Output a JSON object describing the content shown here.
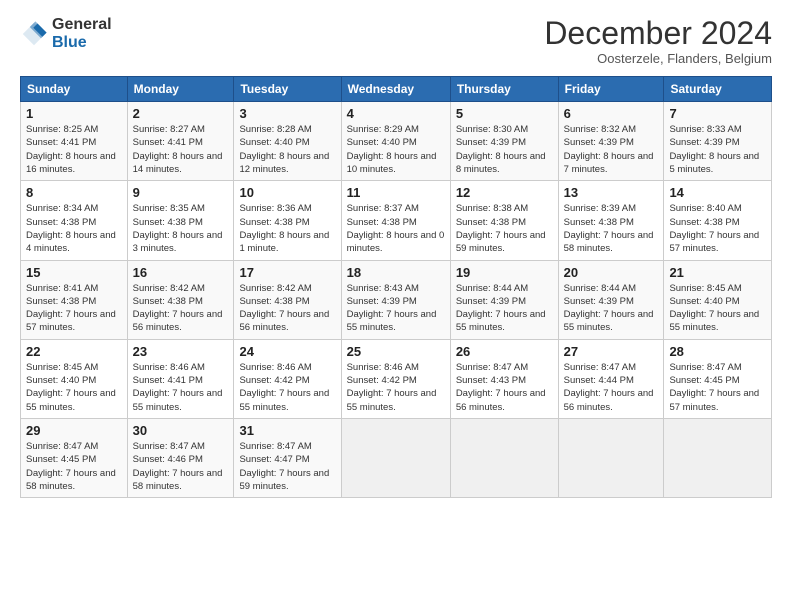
{
  "logo": {
    "line1": "General",
    "line2": "Blue"
  },
  "title": "December 2024",
  "subtitle": "Oosterzele, Flanders, Belgium",
  "headers": [
    "Sunday",
    "Monday",
    "Tuesday",
    "Wednesday",
    "Thursday",
    "Friday",
    "Saturday"
  ],
  "weeks": [
    [
      {
        "day": "1",
        "sunrise": "Sunrise: 8:25 AM",
        "sunset": "Sunset: 4:41 PM",
        "daylight": "Daylight: 8 hours and 16 minutes."
      },
      {
        "day": "2",
        "sunrise": "Sunrise: 8:27 AM",
        "sunset": "Sunset: 4:41 PM",
        "daylight": "Daylight: 8 hours and 14 minutes."
      },
      {
        "day": "3",
        "sunrise": "Sunrise: 8:28 AM",
        "sunset": "Sunset: 4:40 PM",
        "daylight": "Daylight: 8 hours and 12 minutes."
      },
      {
        "day": "4",
        "sunrise": "Sunrise: 8:29 AM",
        "sunset": "Sunset: 4:40 PM",
        "daylight": "Daylight: 8 hours and 10 minutes."
      },
      {
        "day": "5",
        "sunrise": "Sunrise: 8:30 AM",
        "sunset": "Sunset: 4:39 PM",
        "daylight": "Daylight: 8 hours and 8 minutes."
      },
      {
        "day": "6",
        "sunrise": "Sunrise: 8:32 AM",
        "sunset": "Sunset: 4:39 PM",
        "daylight": "Daylight: 8 hours and 7 minutes."
      },
      {
        "day": "7",
        "sunrise": "Sunrise: 8:33 AM",
        "sunset": "Sunset: 4:39 PM",
        "daylight": "Daylight: 8 hours and 5 minutes."
      }
    ],
    [
      {
        "day": "8",
        "sunrise": "Sunrise: 8:34 AM",
        "sunset": "Sunset: 4:38 PM",
        "daylight": "Daylight: 8 hours and 4 minutes."
      },
      {
        "day": "9",
        "sunrise": "Sunrise: 8:35 AM",
        "sunset": "Sunset: 4:38 PM",
        "daylight": "Daylight: 8 hours and 3 minutes."
      },
      {
        "day": "10",
        "sunrise": "Sunrise: 8:36 AM",
        "sunset": "Sunset: 4:38 PM",
        "daylight": "Daylight: 8 hours and 1 minute."
      },
      {
        "day": "11",
        "sunrise": "Sunrise: 8:37 AM",
        "sunset": "Sunset: 4:38 PM",
        "daylight": "Daylight: 8 hours and 0 minutes."
      },
      {
        "day": "12",
        "sunrise": "Sunrise: 8:38 AM",
        "sunset": "Sunset: 4:38 PM",
        "daylight": "Daylight: 7 hours and 59 minutes."
      },
      {
        "day": "13",
        "sunrise": "Sunrise: 8:39 AM",
        "sunset": "Sunset: 4:38 PM",
        "daylight": "Daylight: 7 hours and 58 minutes."
      },
      {
        "day": "14",
        "sunrise": "Sunrise: 8:40 AM",
        "sunset": "Sunset: 4:38 PM",
        "daylight": "Daylight: 7 hours and 57 minutes."
      }
    ],
    [
      {
        "day": "15",
        "sunrise": "Sunrise: 8:41 AM",
        "sunset": "Sunset: 4:38 PM",
        "daylight": "Daylight: 7 hours and 57 minutes."
      },
      {
        "day": "16",
        "sunrise": "Sunrise: 8:42 AM",
        "sunset": "Sunset: 4:38 PM",
        "daylight": "Daylight: 7 hours and 56 minutes."
      },
      {
        "day": "17",
        "sunrise": "Sunrise: 8:42 AM",
        "sunset": "Sunset: 4:38 PM",
        "daylight": "Daylight: 7 hours and 56 minutes."
      },
      {
        "day": "18",
        "sunrise": "Sunrise: 8:43 AM",
        "sunset": "Sunset: 4:39 PM",
        "daylight": "Daylight: 7 hours and 55 minutes."
      },
      {
        "day": "19",
        "sunrise": "Sunrise: 8:44 AM",
        "sunset": "Sunset: 4:39 PM",
        "daylight": "Daylight: 7 hours and 55 minutes."
      },
      {
        "day": "20",
        "sunrise": "Sunrise: 8:44 AM",
        "sunset": "Sunset: 4:39 PM",
        "daylight": "Daylight: 7 hours and 55 minutes."
      },
      {
        "day": "21",
        "sunrise": "Sunrise: 8:45 AM",
        "sunset": "Sunset: 4:40 PM",
        "daylight": "Daylight: 7 hours and 55 minutes."
      }
    ],
    [
      {
        "day": "22",
        "sunrise": "Sunrise: 8:45 AM",
        "sunset": "Sunset: 4:40 PM",
        "daylight": "Daylight: 7 hours and 55 minutes."
      },
      {
        "day": "23",
        "sunrise": "Sunrise: 8:46 AM",
        "sunset": "Sunset: 4:41 PM",
        "daylight": "Daylight: 7 hours and 55 minutes."
      },
      {
        "day": "24",
        "sunrise": "Sunrise: 8:46 AM",
        "sunset": "Sunset: 4:42 PM",
        "daylight": "Daylight: 7 hours and 55 minutes."
      },
      {
        "day": "25",
        "sunrise": "Sunrise: 8:46 AM",
        "sunset": "Sunset: 4:42 PM",
        "daylight": "Daylight: 7 hours and 55 minutes."
      },
      {
        "day": "26",
        "sunrise": "Sunrise: 8:47 AM",
        "sunset": "Sunset: 4:43 PM",
        "daylight": "Daylight: 7 hours and 56 minutes."
      },
      {
        "day": "27",
        "sunrise": "Sunrise: 8:47 AM",
        "sunset": "Sunset: 4:44 PM",
        "daylight": "Daylight: 7 hours and 56 minutes."
      },
      {
        "day": "28",
        "sunrise": "Sunrise: 8:47 AM",
        "sunset": "Sunset: 4:45 PM",
        "daylight": "Daylight: 7 hours and 57 minutes."
      }
    ],
    [
      {
        "day": "29",
        "sunrise": "Sunrise: 8:47 AM",
        "sunset": "Sunset: 4:45 PM",
        "daylight": "Daylight: 7 hours and 58 minutes."
      },
      {
        "day": "30",
        "sunrise": "Sunrise: 8:47 AM",
        "sunset": "Sunset: 4:46 PM",
        "daylight": "Daylight: 7 hours and 58 minutes."
      },
      {
        "day": "31",
        "sunrise": "Sunrise: 8:47 AM",
        "sunset": "Sunset: 4:47 PM",
        "daylight": "Daylight: 7 hours and 59 minutes."
      },
      null,
      null,
      null,
      null
    ]
  ]
}
